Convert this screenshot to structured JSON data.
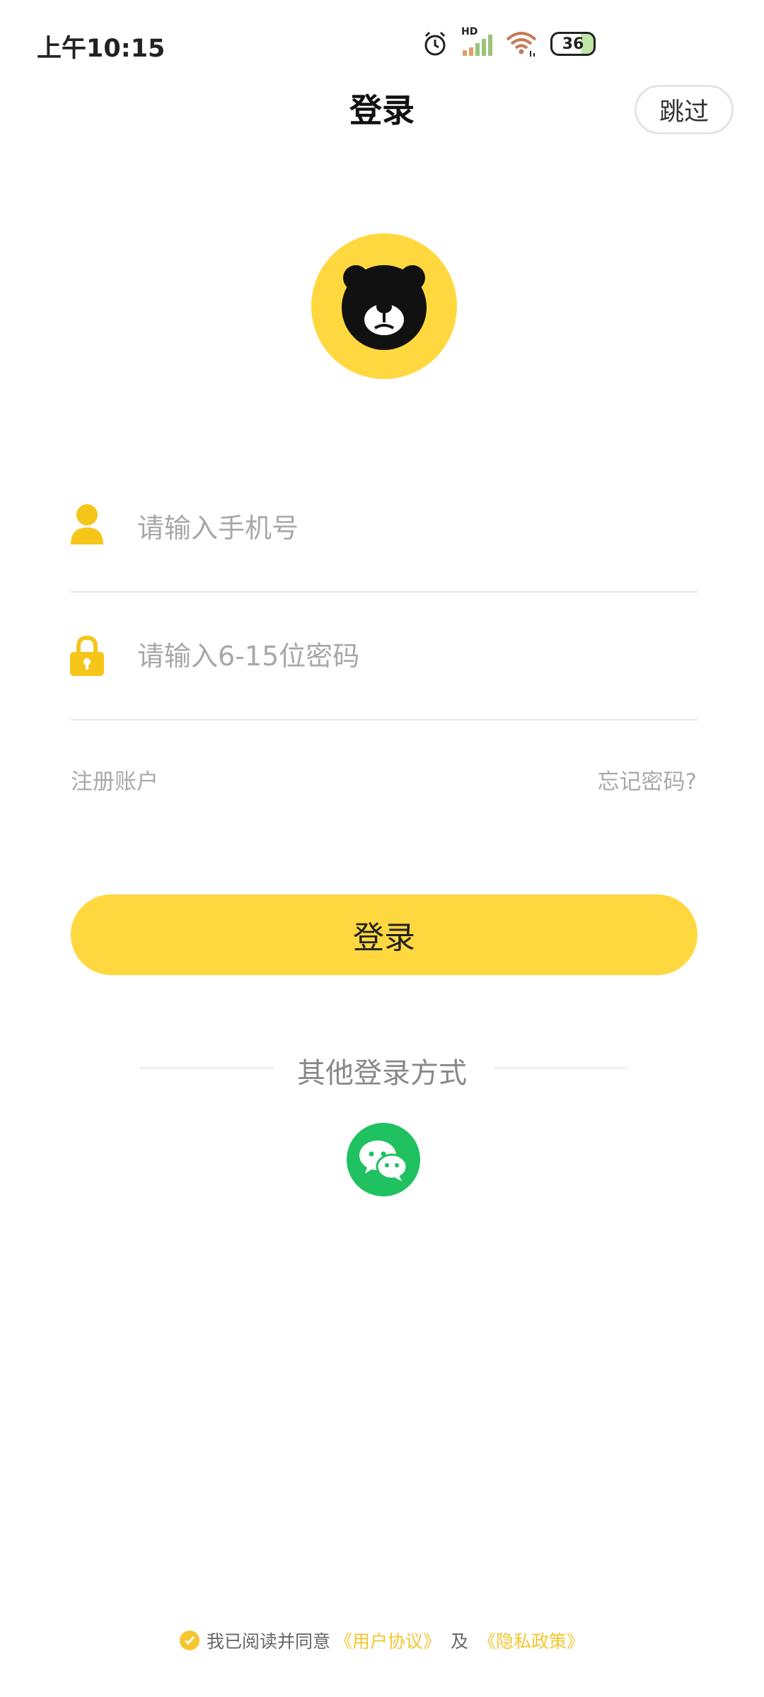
{
  "status_bar": {
    "time": "上午10:15",
    "network": "HD",
    "battery_level": "36"
  },
  "header": {
    "title": "登录",
    "skip_label": "跳过"
  },
  "form": {
    "phone_placeholder": "请输入手机号",
    "password_placeholder": "请输入6-15位密码",
    "register_label": "注册账户",
    "forgot_label": "忘记密码?"
  },
  "login_button_label": "登录",
  "other_login": {
    "title": "其他登录方式",
    "wechat_icon": "wechat-icon"
  },
  "agreement": {
    "prefix": "我已阅读并同意",
    "user_agreement": "《用户协议》",
    "and": "及",
    "privacy_policy": "《隐私政策》"
  },
  "colors": {
    "accent": "#ffd83f",
    "wechat": "#1fc160",
    "link": "#f2c62f"
  }
}
